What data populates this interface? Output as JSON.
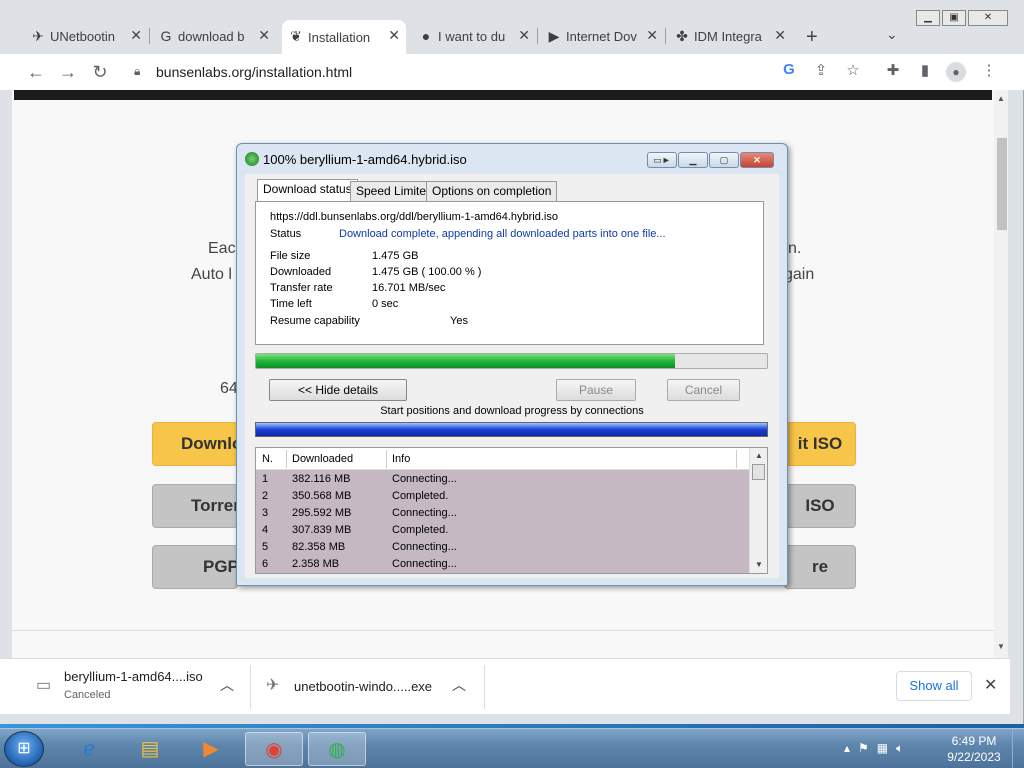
{
  "browser": {
    "tabs": [
      {
        "title": "UNetbootin",
        "icon": "unetbootin-icon",
        "glyph": "✈"
      },
      {
        "title": "download b",
        "icon": "google-icon",
        "glyph": "G"
      },
      {
        "title": "Installation",
        "icon": "bunsenlabs-icon",
        "glyph": "❦"
      },
      {
        "title": "I want to du",
        "icon": "reddit-icon",
        "glyph": "●"
      },
      {
        "title": "Internet Dov",
        "icon": "play-icon",
        "glyph": "▶"
      },
      {
        "title": "IDM Integra",
        "icon": "puzzle-icon",
        "glyph": "✤"
      }
    ],
    "url": "bunsenlabs.org/installation.html"
  },
  "page": {
    "text_left_1": "Eac",
    "text_left_2": "Auto l",
    "text_right_1": "n.",
    "text_right_2": "gain",
    "text_left_3": "64",
    "btn_download_left": "Downlo",
    "btn_download_right": "it ISO",
    "btn_torrent_left": "Torren",
    "btn_torrent_right": "ISO",
    "btn_pgp_left": "PGP",
    "btn_pgp_right": "re"
  },
  "idm": {
    "title": "100% beryllium-1-amd64.hybrid.iso",
    "tabs": [
      "Download status",
      "Speed Limiter",
      "Options on completion"
    ],
    "url": "https://ddl.bunsenlabs.org/ddl/beryllium-1-amd64.hybrid.iso",
    "status_label": "Status",
    "status_value": "Download complete, appending all downloaded parts into one file...",
    "file_size_label": "File size",
    "file_size_value": "1.475  GB",
    "downloaded_label": "Downloaded",
    "downloaded_value": "1.475  GB  ( 100.00 % )",
    "rate_label": "Transfer rate",
    "rate_value": "16.701  MB/sec",
    "time_left_label": "Time left",
    "time_left_value": "0 sec",
    "resume_label": "Resume capability",
    "resume_value": "Yes",
    "progress_fraction": 0.82,
    "hide_details": "<< Hide details",
    "pause": "Pause",
    "cancel": "Cancel",
    "connections_caption": "Start positions and download progress by connections",
    "table_headers": [
      "N.",
      "Downloaded",
      "Info"
    ],
    "connections": [
      {
        "n": "1",
        "downloaded": "382.116  MB",
        "info": "Connecting..."
      },
      {
        "n": "2",
        "downloaded": "350.568  MB",
        "info": "Completed."
      },
      {
        "n": "3",
        "downloaded": "295.592  MB",
        "info": "Connecting..."
      },
      {
        "n": "4",
        "downloaded": "307.839  MB",
        "info": "Completed."
      },
      {
        "n": "5",
        "downloaded": "82.358  MB",
        "info": "Connecting..."
      },
      {
        "n": "6",
        "downloaded": "2.358  MB",
        "info": "Connecting..."
      }
    ]
  },
  "shelf": {
    "item1_name": "beryllium-1-amd64....iso",
    "item1_status": "Canceled",
    "item2_name": "unetbootin-windo.....exe",
    "show_all": "Show all"
  },
  "taskbar": {
    "time": "6:49 PM",
    "date": "9/22/2023"
  }
}
